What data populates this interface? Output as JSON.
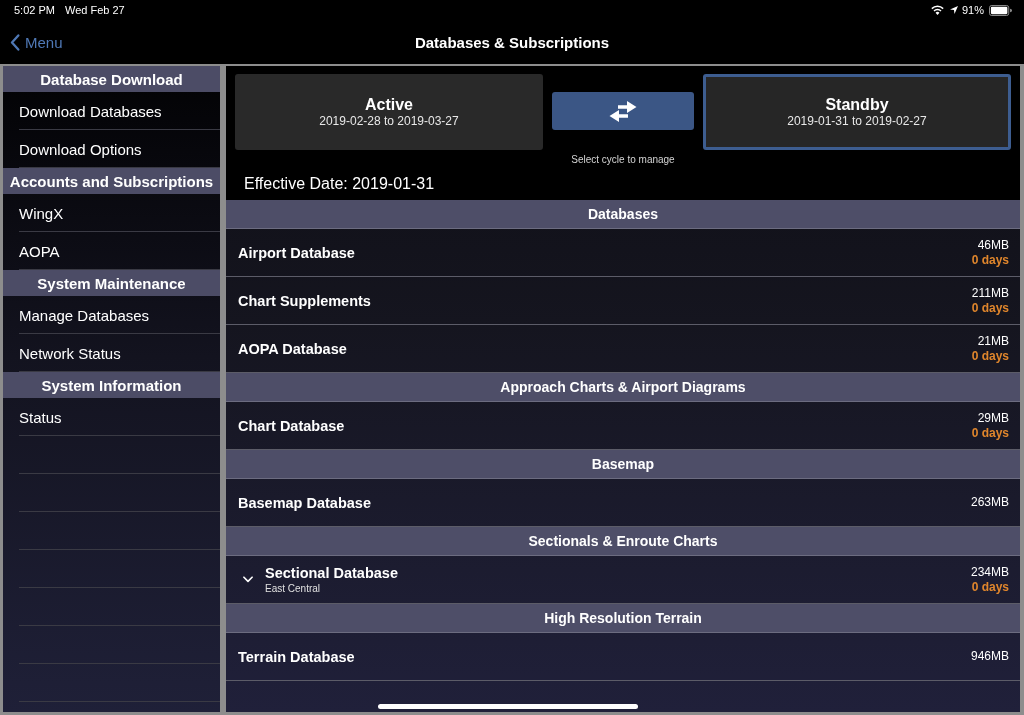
{
  "status_bar": {
    "time": "5:02 PM",
    "date": "Wed Feb 27",
    "battery": "91%"
  },
  "nav_bar": {
    "back": "Menu",
    "title": "Databases & Subscriptions"
  },
  "sidebar": {
    "sections": [
      {
        "title": "Database Download",
        "items": [
          {
            "label": "Download Databases"
          },
          {
            "label": "Download Options"
          }
        ]
      },
      {
        "title": "Accounts and Subscriptions",
        "items": [
          {
            "label": "WingX"
          },
          {
            "label": "AOPA"
          }
        ]
      },
      {
        "title": "System Maintenance",
        "items": [
          {
            "label": "Manage Databases"
          },
          {
            "label": "Network Status"
          }
        ]
      },
      {
        "title": "System Information",
        "items": [
          {
            "label": "Status"
          }
        ]
      }
    ]
  },
  "cycles": [
    {
      "label": "Active",
      "range": "2019-02-28 to 2019-03-27",
      "selected": false
    },
    {
      "label": "Standby",
      "range": "2019-01-31 to 2019-02-27",
      "selected": true
    }
  ],
  "cycle_hint": "Select cycle to manage",
  "effective_date": "Effective Date: 2019-01-31",
  "database_groups": [
    {
      "title": "Databases",
      "rows": [
        {
          "kind": "plain",
          "name": "Airport Database",
          "size": "46MB",
          "age": "0 days"
        },
        {
          "kind": "plain",
          "name": "Chart Supplements",
          "size": "211MB",
          "age": "0 days"
        },
        {
          "kind": "plain",
          "name": "AOPA Database",
          "size": "21MB",
          "age": "0 days"
        }
      ]
    },
    {
      "title": "Approach Charts & Airport Diagrams",
      "rows": [
        {
          "kind": "plain",
          "name": "Chart Database",
          "size": "29MB",
          "age": "0 days"
        }
      ]
    },
    {
      "title": "Basemap",
      "rows": [
        {
          "kind": "plain",
          "name": "Basemap Database",
          "size": "263MB"
        }
      ]
    },
    {
      "title": "Sectionals & Enroute Charts",
      "rows": [
        {
          "kind": "expandable",
          "name": "Sectional Database",
          "region": "East Central",
          "size": "234MB",
          "age": "0 days"
        }
      ]
    },
    {
      "title": "High Resolution Terrain",
      "rows": [
        {
          "kind": "plain",
          "name": "Terrain Database",
          "size": "946MB"
        }
      ]
    }
  ]
}
